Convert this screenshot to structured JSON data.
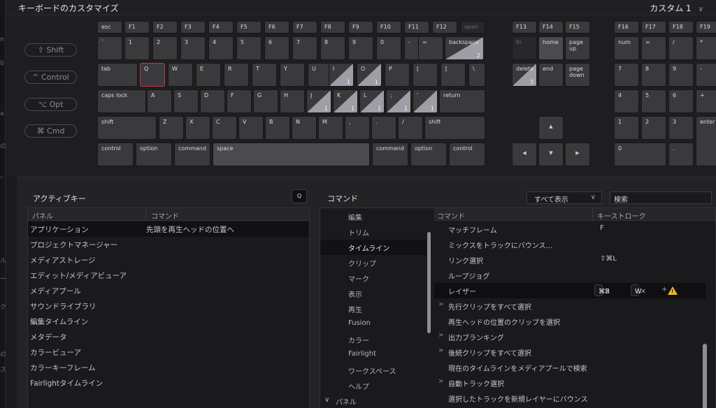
{
  "app": {
    "title": "キーボードのカスタマイズ",
    "preset": "カスタム 1"
  },
  "left_strip": [
    "n",
    "0",
    "a",
    "の",
    "_",
    "ル",
    "ー",
    "ク",
    "の",
    "ス"
  ],
  "modifiers": [
    "⇧ Shift",
    "^ Control",
    "⌥ Opt",
    "⌘ Cmd"
  ],
  "keys": {
    "row0": [
      "esc",
      "F1",
      "F2",
      "F3",
      "F4",
      "F5",
      "F6",
      "F7",
      "F8",
      "F9",
      "F10",
      "F11",
      "F12",
      "open",
      "F13",
      "F14",
      "F15",
      "F16",
      "F17",
      "F18",
      "F19"
    ],
    "row1": [
      "`",
      "1",
      "2",
      "3",
      "4",
      "5",
      "6",
      "7",
      "8",
      "9",
      "0",
      "-",
      "=",
      "backspace",
      "fn",
      "home",
      "page up",
      "num",
      "=",
      "/",
      "*"
    ],
    "row2": [
      "tab",
      "Q",
      "W",
      "E",
      "R",
      "T",
      "Y",
      "U",
      "I",
      "O",
      "P",
      "[",
      "]",
      "\\",
      "delete",
      "end",
      "page down",
      "7",
      "8",
      "9",
      "-"
    ],
    "row3": [
      "caps lock",
      "A",
      "S",
      "D",
      "F",
      "G",
      "H",
      "J",
      "K",
      "L",
      ";",
      "'",
      "return",
      "4",
      "5",
      "6",
      "+"
    ],
    "row4": [
      "shift",
      "Z",
      "X",
      "C",
      "V",
      "B",
      "N",
      "M",
      ",",
      ".",
      "/",
      "shift",
      "1",
      "2",
      "3",
      "enter"
    ],
    "row5": [
      "control",
      "option",
      "command",
      "space",
      "command",
      "option",
      "control",
      "0",
      "."
    ],
    "counts": {
      "backspace": "2",
      "delete": "3",
      "I": "1",
      "O": "1",
      "J": "1",
      "K": "1",
      "L": "1",
      "semicolon": "1",
      "quote": "1"
    }
  },
  "active_keys": {
    "header": "アクティブキー",
    "badge": "Q",
    "columns": [
      "パネル",
      "コマンド"
    ],
    "rows": [
      {
        "panel": "アプリケーション",
        "command": "先頭を再生ヘッドの位置へ"
      },
      {
        "panel": "プロジェクトマネージャー",
        "command": ""
      },
      {
        "panel": "メディアストレージ",
        "command": ""
      },
      {
        "panel": "エディット/メディアビューア",
        "command": ""
      },
      {
        "panel": "メディアプール",
        "command": ""
      },
      {
        "panel": "サウンドライブラリ",
        "command": ""
      },
      {
        "panel": "編集タイムライン",
        "command": ""
      },
      {
        "panel": "メタデータ",
        "command": ""
      },
      {
        "panel": "カラービューア",
        "command": ""
      },
      {
        "panel": "カラーキーフレーム",
        "command": ""
      },
      {
        "panel": "Fairlightタイムライン",
        "command": ""
      }
    ]
  },
  "commands": {
    "header": "コマンド",
    "filter": "すべて表示",
    "search": "検索",
    "categories": [
      "編集",
      "トリム",
      "タイムライン",
      "クリップ",
      "マーク",
      "表示",
      "再生",
      "Fusion",
      "カラー",
      "Fairlight",
      "ワークスペース",
      "ヘルプ",
      "パネル"
    ],
    "selected_category": "タイムライン",
    "columns": [
      "コマンド",
      "キーストローク"
    ],
    "rows": [
      {
        "caret": "",
        "name": "マッチフレーム",
        "key": "F"
      },
      {
        "caret": "",
        "name": "ミックスをトラックにバウンス...",
        "key": ""
      },
      {
        "caret": "",
        "name": "リンク選択",
        "key": "⇧⌘L"
      },
      {
        "caret": "",
        "name": "ループジョグ",
        "key": ""
      },
      {
        "caret": "",
        "name": "レイザー",
        "key": ""
      },
      {
        "caret": ">",
        "name": "先行クリップをすべて選択",
        "key": ""
      },
      {
        "caret": "",
        "name": "再生ヘッドの位置のクリップを選択",
        "key": ""
      },
      {
        "caret": ">",
        "name": "出力ブランキング",
        "key": ""
      },
      {
        "caret": ">",
        "name": "後続クリップをすべて選択",
        "key": ""
      },
      {
        "caret": "",
        "name": "現在のタイムラインをメディアプールで検索",
        "key": ""
      },
      {
        "caret": ">",
        "name": "自動トラック選択",
        "key": ""
      },
      {
        "caret": "",
        "name": "選択したトラックを新規レイヤーにバウンス",
        "key": ""
      }
    ],
    "razor_keys": [
      "⌘B",
      "W"
    ],
    "plus": "+",
    "warn_icon": "!"
  }
}
